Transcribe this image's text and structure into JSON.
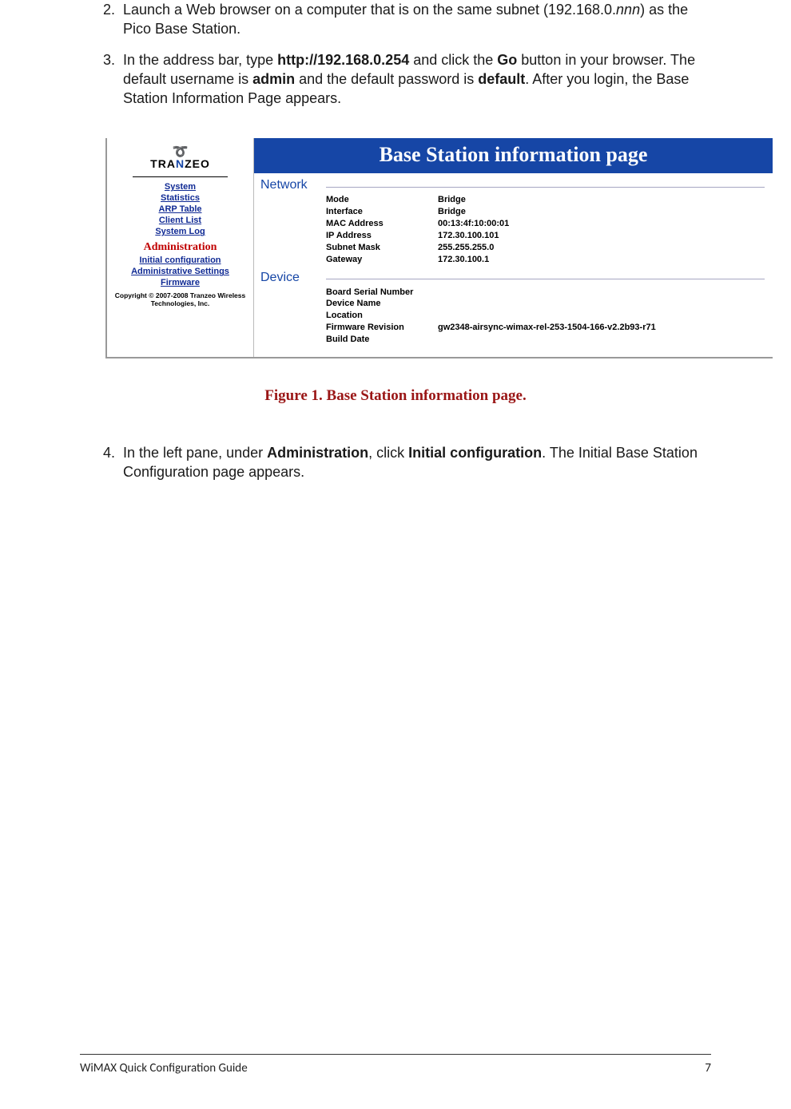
{
  "steps": {
    "s2": {
      "num": "2.",
      "pre": "Launch a Web browser on a computer that is on the same subnet (192.168.0.",
      "italic": "nnn",
      "post": ") as the Pico Base Station."
    },
    "s3": {
      "num": "3.",
      "t1": "In the address bar, type ",
      "b1": "http://192.168.0.254",
      "t2": " and click the ",
      "b2": "Go",
      "t3": " button in your browser. The default username is ",
      "b3": "admin",
      "t4": " and the default password is ",
      "b4": "default",
      "t5": ". After you login, the Base Station Information Page appears."
    },
    "s4": {
      "num": "4.",
      "t1": "In the left pane, under ",
      "b1": "Administration",
      "t2": ", click ",
      "b2": "Initial configuration",
      "t3": ". The Initial Base Station Configuration page appears."
    }
  },
  "shot": {
    "brand_pre": "TRA",
    "brand_n": "N",
    "brand_post": "ZEO",
    "swirl": "➰",
    "nav": {
      "system": "System",
      "statistics": "Statistics",
      "arp": "ARP Table",
      "client": "Client List",
      "syslog": "System Log"
    },
    "admin_head": "Administration",
    "admin_nav": {
      "initconf": "Initial configuration",
      "adminset": "Administrative Settings",
      "firmware": "Firmware"
    },
    "copyright_l1": "Copyright © 2007-2008 Tranzeo Wireless",
    "copyright_l2": "Technologies, Inc.",
    "banner": "Base Station information page",
    "sections": {
      "network": {
        "label": "Network",
        "rows": [
          {
            "k": "Mode",
            "v": "Bridge"
          },
          {
            "k": "Interface",
            "v": "Bridge"
          },
          {
            "k": "MAC Address",
            "v": "00:13:4f:10:00:01"
          },
          {
            "k": "IP Address",
            "v": "172.30.100.101"
          },
          {
            "k": "Subnet Mask",
            "v": "255.255.255.0"
          },
          {
            "k": "Gateway",
            "v": "172.30.100.1"
          }
        ]
      },
      "device": {
        "label": "Device",
        "rows": [
          {
            "k": "Board Serial Number",
            "v": ""
          },
          {
            "k": "Device Name",
            "v": ""
          },
          {
            "k": "Location",
            "v": ""
          },
          {
            "k": "Firmware Revision",
            "v": "gw2348-airsync-wimax-rel-253-1504-166-v2.2b93-r71"
          },
          {
            "k": "Build Date",
            "v": ""
          }
        ]
      }
    }
  },
  "figure_caption": "Figure 1. Base Station information page.",
  "footer": {
    "left": "WiMAX Quick Configuration Guide",
    "right": "7"
  }
}
